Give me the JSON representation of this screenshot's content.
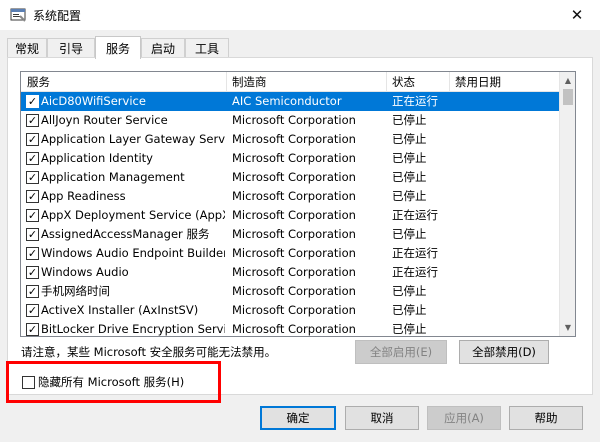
{
  "window": {
    "title": "系统配置",
    "close_glyph": "✕"
  },
  "tabs": [
    {
      "label": "常规",
      "active": false
    },
    {
      "label": "引导",
      "active": false
    },
    {
      "label": "服务",
      "active": true
    },
    {
      "label": "启动",
      "active": false
    },
    {
      "label": "工具",
      "active": false
    }
  ],
  "columns": {
    "service": "服务",
    "manufacturer": "制造商",
    "status": "状态",
    "disabled_date": "禁用日期"
  },
  "services": [
    {
      "name": "AicD80WifiService",
      "manufacturer": "AIC Semiconductor",
      "status": "正在运行",
      "date": "",
      "checked": true,
      "selected": true
    },
    {
      "name": "AllJoyn Router Service",
      "manufacturer": "Microsoft Corporation",
      "status": "已停止",
      "date": "",
      "checked": true,
      "selected": false
    },
    {
      "name": "Application Layer Gateway Service",
      "manufacturer": "Microsoft Corporation",
      "status": "已停止",
      "date": "",
      "checked": true,
      "selected": false
    },
    {
      "name": "Application Identity",
      "manufacturer": "Microsoft Corporation",
      "status": "已停止",
      "date": "",
      "checked": true,
      "selected": false
    },
    {
      "name": "Application Management",
      "manufacturer": "Microsoft Corporation",
      "status": "已停止",
      "date": "",
      "checked": true,
      "selected": false
    },
    {
      "name": "App Readiness",
      "manufacturer": "Microsoft Corporation",
      "status": "已停止",
      "date": "",
      "checked": true,
      "selected": false
    },
    {
      "name": "AppX Deployment Service (AppX...",
      "manufacturer": "Microsoft Corporation",
      "status": "正在运行",
      "date": "",
      "checked": true,
      "selected": false
    },
    {
      "name": "AssignedAccessManager 服务",
      "manufacturer": "Microsoft Corporation",
      "status": "已停止",
      "date": "",
      "checked": true,
      "selected": false
    },
    {
      "name": "Windows Audio Endpoint Builder",
      "manufacturer": "Microsoft Corporation",
      "status": "正在运行",
      "date": "",
      "checked": true,
      "selected": false
    },
    {
      "name": "Windows Audio",
      "manufacturer": "Microsoft Corporation",
      "status": "正在运行",
      "date": "",
      "checked": true,
      "selected": false
    },
    {
      "name": "手机网络时间",
      "manufacturer": "Microsoft Corporation",
      "status": "已停止",
      "date": "",
      "checked": true,
      "selected": false
    },
    {
      "name": "ActiveX Installer (AxInstSV)",
      "manufacturer": "Microsoft Corporation",
      "status": "已停止",
      "date": "",
      "checked": true,
      "selected": false
    },
    {
      "name": "BitLocker Drive Encryption Service",
      "manufacturer": "Microsoft Corporation",
      "status": "已停止",
      "date": "",
      "checked": true,
      "selected": false
    }
  ],
  "notice": "请注意，某些 Microsoft 安全服务可能无法禁用。",
  "buttons": {
    "enable_all": "全部启用(E)",
    "disable_all": "全部禁用(D)",
    "ok": "确定",
    "cancel": "取消",
    "apply": "应用(A)",
    "help": "帮助"
  },
  "hide_microsoft": {
    "label": "隐藏所有 Microsoft 服务(H)",
    "checked": false
  },
  "colors": {
    "selection": "#0078d7",
    "highlight_box": "#ff0000",
    "default_button_border": "#0078d7"
  }
}
